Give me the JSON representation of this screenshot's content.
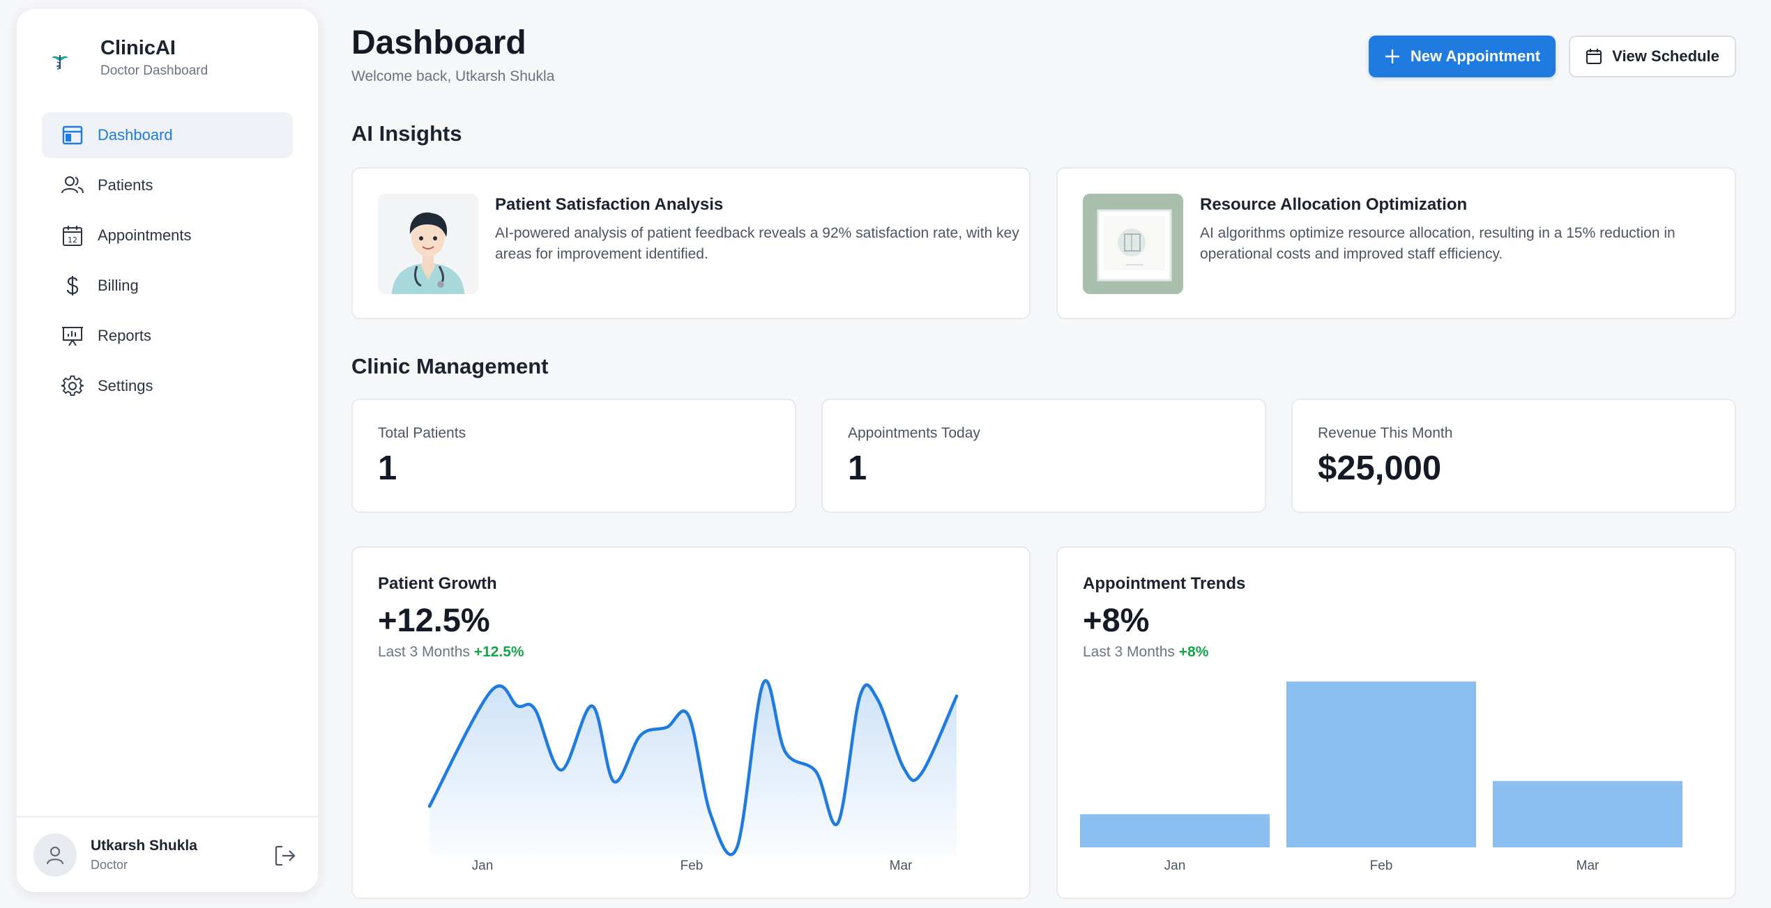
{
  "brand": {
    "name": "ClinicAI",
    "subtitle": "Doctor Dashboard",
    "logo_icon": "caduceus-logo-icon"
  },
  "sidebar": {
    "items": [
      {
        "label": "Dashboard",
        "icon": "dashboard-icon",
        "active": true
      },
      {
        "label": "Patients",
        "icon": "users-icon",
        "active": false
      },
      {
        "label": "Appointments",
        "icon": "calendar-icon",
        "active": false
      },
      {
        "label": "Billing",
        "icon": "dollar-icon",
        "active": false
      },
      {
        "label": "Reports",
        "icon": "presentation-chart-icon",
        "active": false
      },
      {
        "label": "Settings",
        "icon": "gear-icon",
        "active": false
      }
    ],
    "user": {
      "name": "Utkarsh Shukla",
      "role": "Doctor"
    }
  },
  "header": {
    "title": "Dashboard",
    "welcome": "Welcome back, Utkarsh Shukla",
    "primary_button": "New Appointment",
    "secondary_button": "View Schedule"
  },
  "insights": {
    "section_title": "AI Insights",
    "cards": [
      {
        "title": "Patient Satisfaction Analysis",
        "body": "AI-powered analysis of patient feedback reveals a 92% satisfaction rate, with key areas for improvement identified."
      },
      {
        "title": "Resource Allocation Optimization",
        "body": "AI algorithms optimize resource allocation, resulting in a 15% reduction in operational costs and improved staff efficiency."
      }
    ]
  },
  "management": {
    "section_title": "Clinic Management",
    "stats": [
      {
        "label": "Total Patients",
        "value": "1"
      },
      {
        "label": "Appointments Today",
        "value": "1"
      },
      {
        "label": "Revenue This Month",
        "value": "$25,000"
      }
    ]
  },
  "charts": {
    "growth": {
      "title": "Patient Growth",
      "big": "+12.5%",
      "period": "Last 3 Months",
      "delta": "+12.5%"
    },
    "appointments": {
      "title": "Appointment Trends",
      "big": "+8%",
      "period": "Last 3 Months",
      "delta": "+8%"
    }
  },
  "colors": {
    "accent": "#1f7be0",
    "positive": "#17a34a",
    "bar": "#8bbff2"
  },
  "chart_data": [
    {
      "type": "area",
      "title": "Patient Growth",
      "categories": [
        "Jan",
        "Feb",
        "Mar"
      ],
      "x": [
        0,
        0.7,
        1,
        1.2,
        1.5,
        1.85,
        2.1,
        2.4,
        2.7,
        2.95,
        3.2,
        3.5,
        3.8,
        4.05,
        4.4,
        4.65,
        4.9,
        5.1,
        5.4,
        5.6,
        6.0
      ],
      "values": [
        0.25,
        0.95,
        0.86,
        0.84,
        0.47,
        0.86,
        0.4,
        0.68,
        0.73,
        0.8,
        0.2,
        0.0,
        1.0,
        0.58,
        0.46,
        0.15,
        0.92,
        0.9,
        0.48,
        0.45,
        0.92
      ],
      "grid": false
    },
    {
      "type": "bar",
      "title": "Appointment Trends",
      "categories": [
        "Jan",
        "Feb",
        "Mar"
      ],
      "values": [
        1,
        5,
        2
      ],
      "grid": false
    }
  ]
}
